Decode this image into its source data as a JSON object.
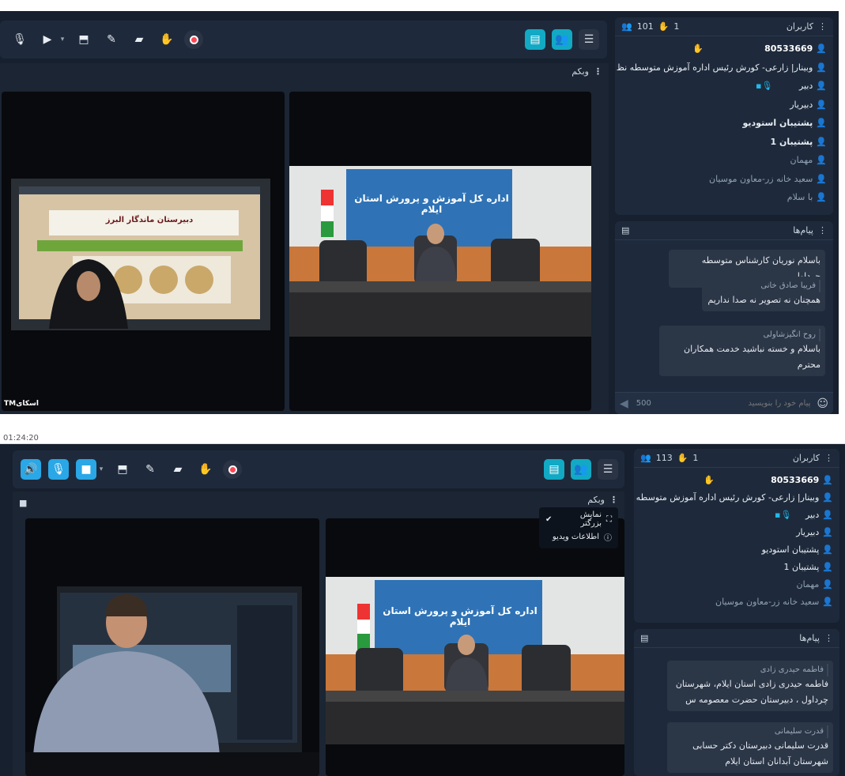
{
  "screen1": {
    "toolbar": {
      "icons": [
        "mic-off-icon",
        "camera-off-icon",
        "share-screen-icon",
        "brush-icon",
        "folder-icon",
        "raise-hand-icon",
        "record-icon"
      ]
    },
    "right_icons": [
      "chat-icon",
      "users-icon",
      "menu-icon"
    ],
    "webcam_title": "وبکم",
    "users_header": {
      "title": "کاربران",
      "count": "101",
      "hands": "1"
    },
    "users": [
      {
        "name": "80533669",
        "type": "guest"
      },
      {
        "name": "وبینار| زارعی- کورش رئیس اداره آموزش متوسطه نظ",
        "type": "host"
      },
      {
        "name": "دبیر",
        "type": "host"
      },
      {
        "name": "دبیریار",
        "type": "host"
      },
      {
        "name": "پشتیبان استودیو",
        "type": "host"
      },
      {
        "name": "پشتیبان 1",
        "type": "host"
      },
      {
        "name": "مهمان",
        "type": "guest"
      },
      {
        "name": "سعید خانه زر-معاون موسیان",
        "type": "guest"
      },
      {
        "name": "با سلام",
        "type": "guest"
      }
    ],
    "chat_header": {
      "title": "پیام‌ها"
    },
    "messages": [
      {
        "author": "",
        "text": "باسلام نوریان کارشناس متوسطه چرداول"
      },
      {
        "author": "فریبا صادق خانی",
        "text": "همچنان نه تصویر نه صدا نداریم"
      },
      {
        "author": "روح انگیزشاولی",
        "text": "باسلام و خسته نباشید خدمت همکاران محترم"
      }
    ],
    "chat_input": {
      "placeholder": "پیام خود را بنویسید",
      "counter": "500"
    },
    "watermark": "TMاسکای",
    "banner": "اداره کل آموزش و پرورش استان ایلام",
    "screen_banner": "دبیرستان ماندگار البرز"
  },
  "screen2": {
    "clock": "01:24:20",
    "toolbar": {
      "icons": [
        "speaker-icon",
        "mic-icon",
        "camera-icon",
        "share-screen-icon",
        "brush-icon",
        "folder-icon",
        "raise-hand-icon",
        "record-icon"
      ]
    },
    "right_icons": [
      "chat-icon",
      "users-icon",
      "menu-icon"
    ],
    "webcam_title": "وبکم",
    "popup": {
      "item1": "نمایش بزرگتر",
      "item2": "اطلاعات ویدیو"
    },
    "users_header": {
      "title": "کاربران",
      "count": "113",
      "hands": "1"
    },
    "users": [
      {
        "name": "80533669",
        "type": "guest"
      },
      {
        "name": "وبینار| زارعی- کورش رئیس اداره آموزش متوسطه نظ",
        "type": "host"
      },
      {
        "name": "دبیر",
        "type": "host"
      },
      {
        "name": "دبیریار",
        "type": "host"
      },
      {
        "name": "پشتیبان استودیو",
        "type": "host"
      },
      {
        "name": "پشتیبان 1",
        "type": "host"
      },
      {
        "name": "مهمان",
        "type": "guest"
      },
      {
        "name": "سعید خانه زر-معاون موسیان",
        "type": "guest"
      }
    ],
    "chat_header": {
      "title": "پیام‌ها"
    },
    "messages": [
      {
        "author": "فاطمه حیدری زادی",
        "text": "فاطمه حیدری زادی استان ایلام، شهرستان چرداول ، دبیرستان حضرت معصومه س"
      },
      {
        "author": "قدرت سلیمانی",
        "text": "قدرت سلیمانی دبیرستان دکتر حسابی شهرستان آبدانان استان ایلام"
      }
    ],
    "banner": "اداره کل آموزش و پرورش استان ایلام"
  },
  "colors": {
    "accent": "#2aa7e6",
    "panel": "#1e2a3b",
    "bg": "#16202e",
    "record": "#ff4757"
  }
}
